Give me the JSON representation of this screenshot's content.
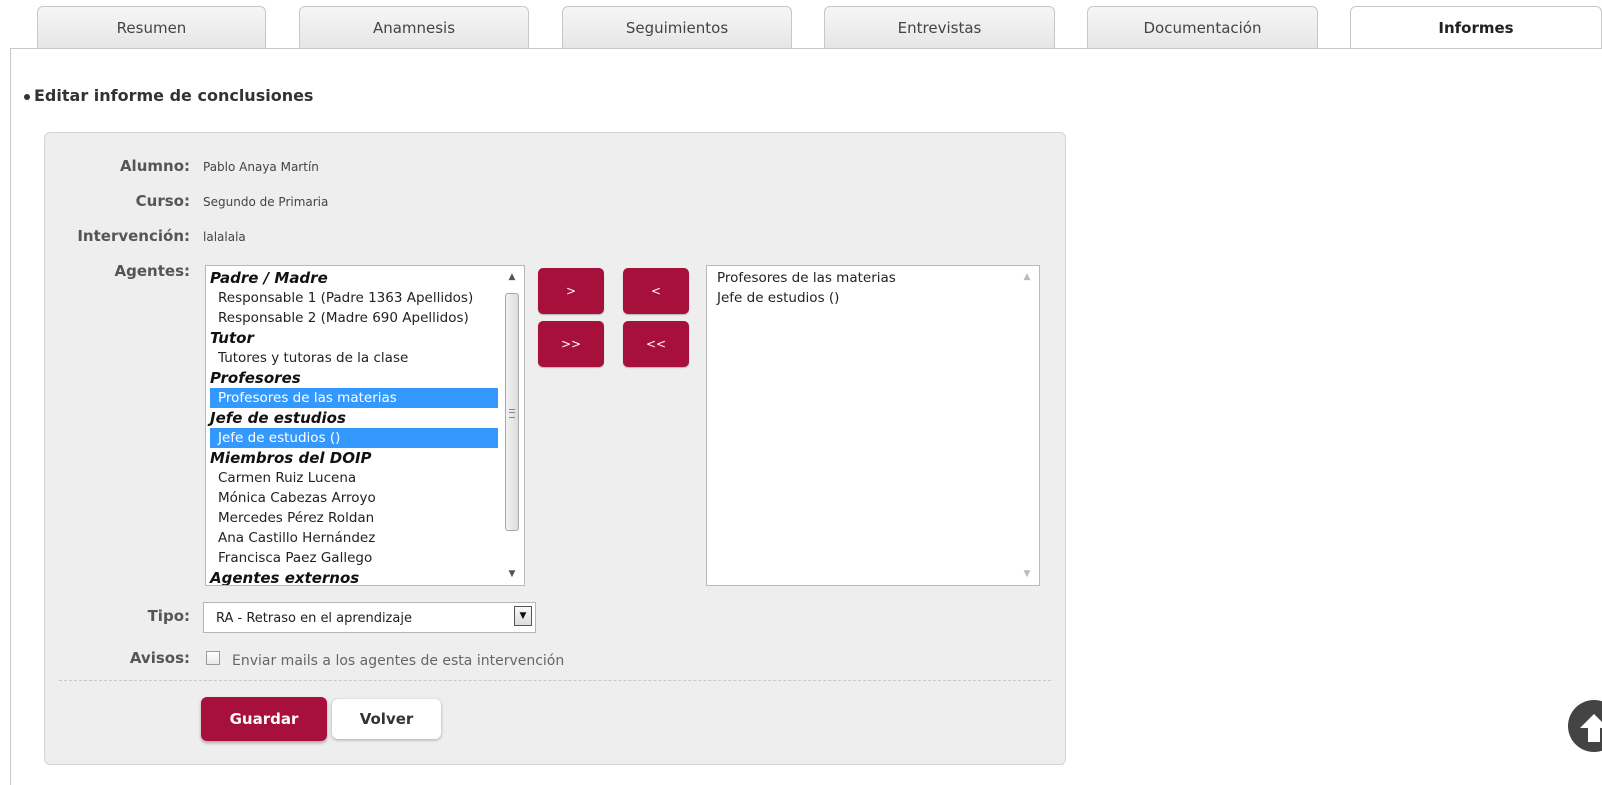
{
  "tabs": [
    {
      "label": "Resumen",
      "active": false
    },
    {
      "label": "Anamnesis",
      "active": false
    },
    {
      "label": "Seguimientos",
      "active": false
    },
    {
      "label": "Entrevistas",
      "active": false
    },
    {
      "label": "Documentación",
      "active": false
    },
    {
      "label": "Informes",
      "active": true
    }
  ],
  "section_title": "Editar informe de conclusiones",
  "form": {
    "alumno_label": "Alumno:",
    "alumno_value": "Pablo Anaya Martín",
    "curso_label": "Curso:",
    "curso_value": "Segundo de Primaria",
    "intervencion_label": "Intervención:",
    "intervencion_value": "lalalala",
    "agentes_label": "Agentes:",
    "available_agents": [
      {
        "text": "Padre / Madre",
        "group": true
      },
      {
        "text": "Responsable 1 (Padre 1363 Apellidos)"
      },
      {
        "text": "Responsable 2 (Madre 690 Apellidos)"
      },
      {
        "text": "Tutor",
        "group": true
      },
      {
        "text": "Tutores y tutoras de la clase"
      },
      {
        "text": "Profesores",
        "group": true
      },
      {
        "text": "Profesores de las materias",
        "selected": true
      },
      {
        "text": "Jefe de estudios",
        "group": true
      },
      {
        "text": "Jefe de estudios ()",
        "selected": true
      },
      {
        "text": "Miembros del DOIP",
        "group": true
      },
      {
        "text": "Carmen Ruiz Lucena"
      },
      {
        "text": "Mónica Cabezas Arroyo"
      },
      {
        "text": "Mercedes Pérez Roldan"
      },
      {
        "text": "Ana Castillo Hernández"
      },
      {
        "text": "Francisca Paez Gallego"
      },
      {
        "text": "Agentes externos",
        "group": true
      }
    ],
    "move_buttons": {
      "add_one": ">",
      "remove_one": "<",
      "add_all": ">>",
      "remove_all": "<<"
    },
    "chosen_agents": [
      "Profesores de las materias",
      "Jefe de estudios ()"
    ],
    "tipo_label": "Tipo:",
    "tipo_value": "RA - Retraso en el aprendizaje",
    "avisos_label": "Avisos:",
    "avisos_checked": false,
    "avisos_text": "Enviar mails a los agentes de esta intervención",
    "save_label": "Guardar",
    "back_label": "Volver"
  },
  "colors": {
    "accent": "#a8103c",
    "selection": "#3399ff",
    "panel_bg": "#eeeeee"
  },
  "icons": {
    "scroll_up": "triangle-up",
    "scroll_down": "triangle-down",
    "select_dropdown": "triangle-down",
    "back_to_top": "arrow-up-icon"
  }
}
